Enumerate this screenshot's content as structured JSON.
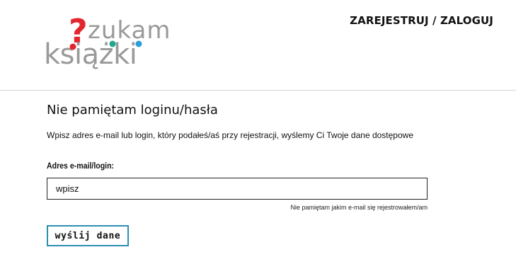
{
  "header": {
    "logo": {
      "line1": "zukam",
      "line2": "książki",
      "question_mark": "?",
      "colors": {
        "text": "#9a9a9a",
        "question_mark": "#e3262d",
        "dot_red": "#e3262d",
        "dot_teal": "#1fa88e",
        "dot_blue": "#2a9fd8"
      }
    },
    "auth_link": "ZAREJESTRUJ / ZALOGUJ"
  },
  "main": {
    "title": "Nie pamiętam loginu/hasła",
    "instructions": "Wpisz adres e-mail lub login, który podałeś/aś przy rejestracji, wyślemy Ci Twoje dane dostępowe",
    "field_label": "Adres e-mail/login:",
    "input": {
      "value": "",
      "placeholder": "wpisz"
    },
    "forgot_link": "Nie pamiętam jakim e-mail się rejestrowałem/am",
    "submit_label": "wyślij dane"
  },
  "colors": {
    "button_border": "#2c8fb0",
    "divider": "#d4d4d4"
  }
}
